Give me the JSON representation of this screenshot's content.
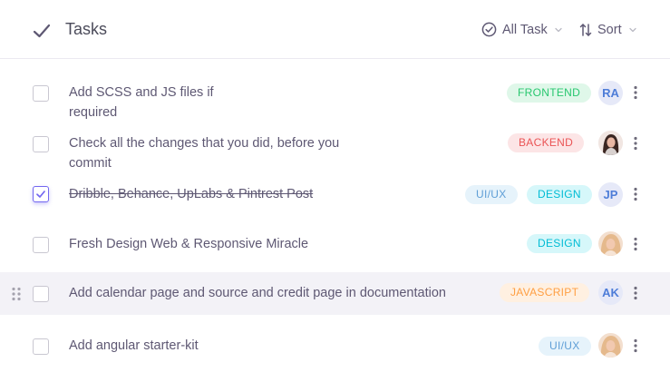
{
  "header": {
    "title": "Tasks",
    "filter_label": "All Task",
    "sort_label": "Sort"
  },
  "tasks": [
    {
      "title_line1": "Add SCSS and JS files if",
      "title_line2": "required",
      "done": false,
      "tags": [
        {
          "label": "FRONTEND",
          "kind": "frontend"
        }
      ],
      "avatar": {
        "type": "initials",
        "text": "RA"
      }
    },
    {
      "title_line1": "Check all the changes that you did, before you",
      "title_line2": "commit",
      "done": false,
      "tags": [
        {
          "label": "BACKEND",
          "kind": "backend"
        }
      ],
      "avatar": {
        "type": "photo",
        "icon": "user-photo-woman-dark-hair"
      }
    },
    {
      "title_line1": "Dribble, Behance, UpLabs & Pintrest Post",
      "done": true,
      "tags": [
        {
          "label": "UI/UX",
          "kind": "uiux"
        },
        {
          "label": "DESIGN",
          "kind": "design"
        }
      ],
      "avatar": {
        "type": "initials",
        "text": "JP"
      }
    },
    {
      "title_line1": "Fresh Design Web & Responsive Miracle",
      "done": false,
      "tags": [
        {
          "label": "DESIGN",
          "kind": "design"
        }
      ],
      "avatar": {
        "type": "photo",
        "icon": "user-photo-woman-blonde"
      }
    },
    {
      "title_line1": "Add calendar page and source and credit page in documentation",
      "done": false,
      "tags": [
        {
          "label": "JAVASCRIPT",
          "kind": "js"
        }
      ],
      "avatar": {
        "type": "initials",
        "text": "AK"
      }
    },
    {
      "title_line1": "Add angular starter-kit",
      "done": false,
      "tags": [
        {
          "label": "UI/UX",
          "kind": "uiux"
        }
      ],
      "avatar": {
        "type": "photo",
        "icon": "user-photo-woman-blonde"
      }
    }
  ],
  "colors": {
    "primary": "#7367f0",
    "frontend": "#28c76f",
    "backend": "#ea5455",
    "design": "#00cfe8",
    "javascript": "#ff9f43",
    "uiux": "#5e9ed6"
  }
}
